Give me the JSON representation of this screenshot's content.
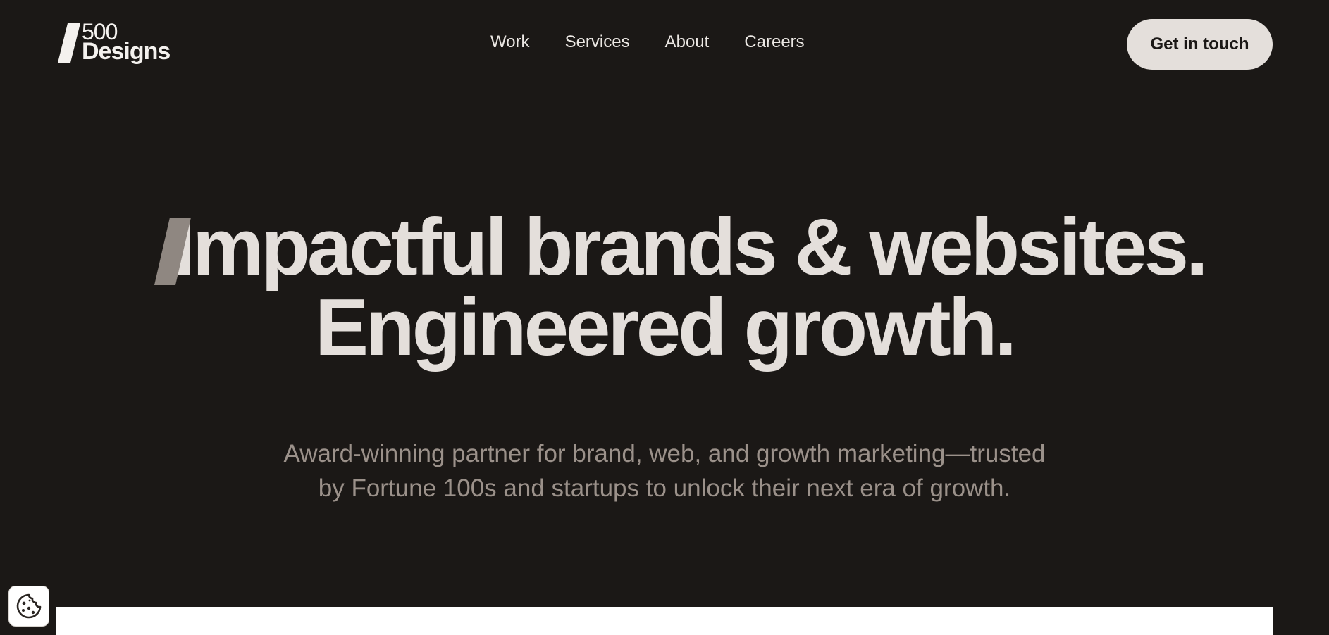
{
  "header": {
    "logo": {
      "number": "500",
      "word": "Designs"
    },
    "nav": {
      "items": [
        {
          "label": "Work"
        },
        {
          "label": "Services"
        },
        {
          "label": "About"
        },
        {
          "label": "Careers"
        }
      ]
    },
    "cta_label": "Get in touch"
  },
  "hero": {
    "line1": "Impactful brands & websites.",
    "line2": "Engineered growth.",
    "subtitle_line1": "Award-winning partner for brand, web, and growth marketing—trusted",
    "subtitle_line2": "by Fortune 100s and startups to unlock their next era of growth."
  },
  "cookie": {
    "icon": "cookie-icon"
  },
  "colors": {
    "background": "#1b1816",
    "headline": "#e4dfdb",
    "subtitle": "#9b918a",
    "accent_slash": "#8f8781",
    "button": "#e4dfdb",
    "button_text": "#1b1816"
  }
}
